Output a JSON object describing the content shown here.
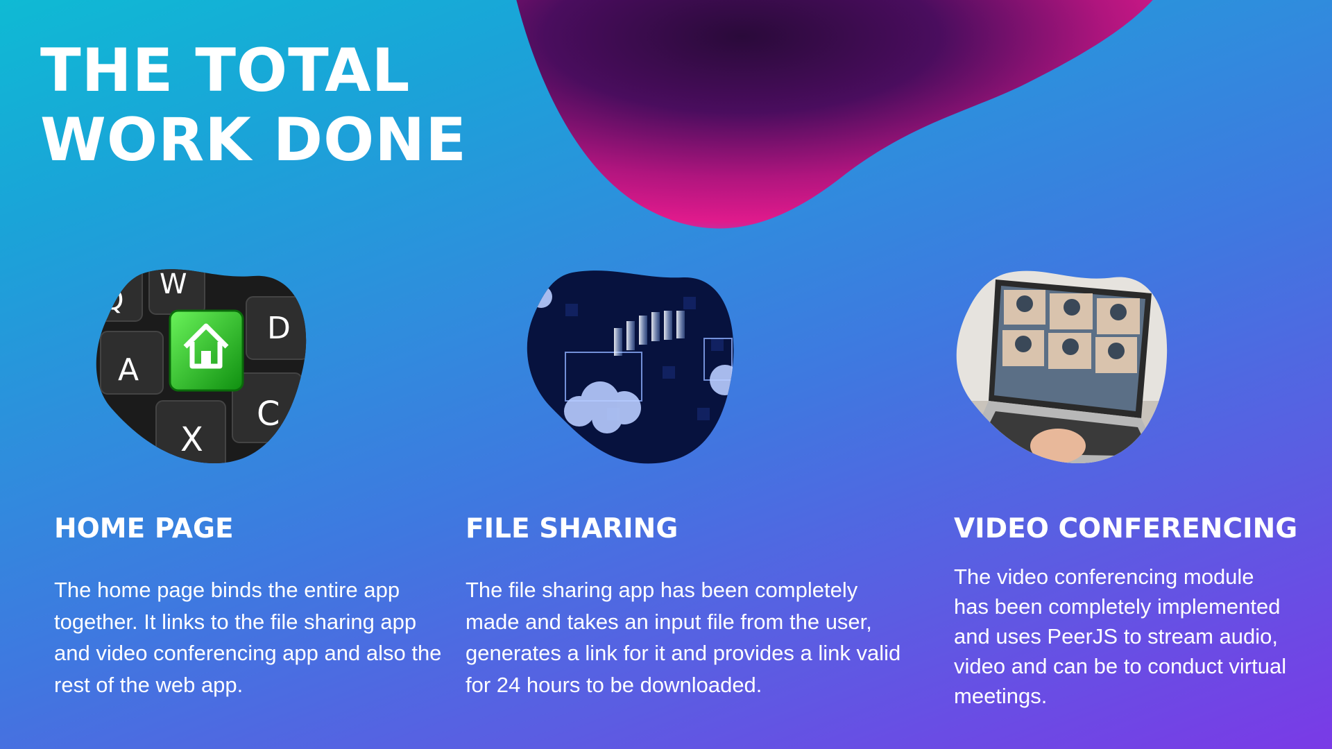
{
  "slide": {
    "title_line1": "THE TOTAL",
    "title_line2": "WORK DONE"
  },
  "colors": {
    "background_start": "#0fbad4",
    "background_end": "#7a3ae6",
    "blob_dark": "#2a0a3a",
    "blob_magenta": "#e01a8c",
    "text": "#ffffff",
    "keyboard_key_green": "#22c020"
  },
  "cards": [
    {
      "heading": "HOME PAGE",
      "description": "The home page binds the entire app together. It links to the file sharing app and video conferencing app and also the rest of the web app.",
      "image": "keyboard-home-key-icon",
      "keys": [
        "Q",
        "W",
        "D",
        "A",
        "C",
        "X"
      ]
    },
    {
      "heading": "FILE SHARING",
      "description": "The file sharing app has been completely made and takes an input file from the user, generates a link for it and provides a link valid for 24 hours to be downloaded.",
      "image": "cloud-file-transfer-icon"
    },
    {
      "heading": "VIDEO CONFERENCING",
      "description": "The video conferencing module has been completely implemented and uses PeerJS to stream audio, video and can be to conduct virtual meetings.",
      "image": "laptop-video-call-icon"
    }
  ]
}
